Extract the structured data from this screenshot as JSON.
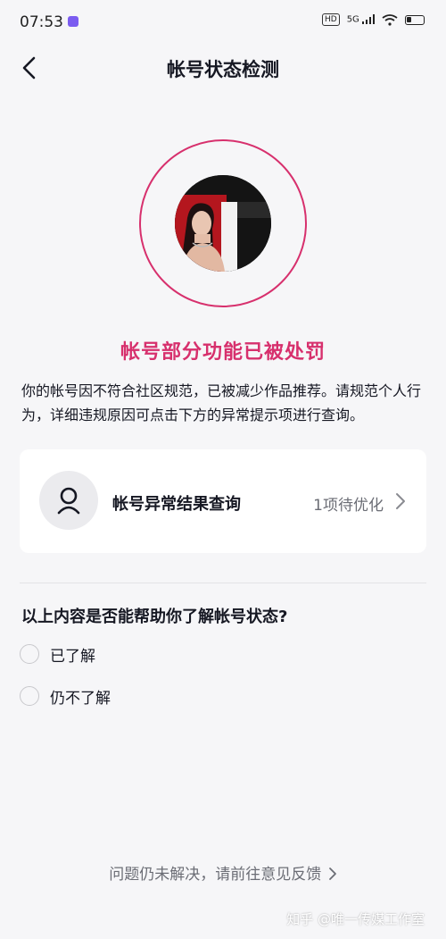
{
  "status_bar": {
    "time": "07:53",
    "hd_label": "HD",
    "network_label": "5G"
  },
  "nav": {
    "title": "帐号状态检测"
  },
  "penalty": {
    "title": "帐号部分功能已被处罚",
    "description": "你的帐号因不符合社区规范，已被减少作品推荐。请规范个人行为，详细违规原因可点击下方的异常提示项进行查询。"
  },
  "result_card": {
    "label": "帐号异常结果查询",
    "count_text": "1项待优化"
  },
  "survey": {
    "question": "以上内容是否能帮助你了解帐号状态?",
    "options": [
      {
        "label": "已了解"
      },
      {
        "label": "仍不了解"
      }
    ]
  },
  "footer": {
    "feedback_text": "问题仍未解决，请前往意见反馈"
  },
  "watermark": {
    "text": "知乎 @唯一传媒工作室"
  },
  "colors": {
    "accent": "#d7306d",
    "background": "#f6f6f8",
    "card": "#ffffff"
  },
  "icons": {
    "back": "chevron-left-icon",
    "result": "user-icon",
    "card_arrow": "chevron-right-icon",
    "footer_arrow": "chevron-right-icon"
  }
}
